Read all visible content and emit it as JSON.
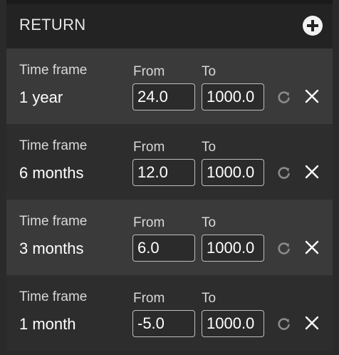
{
  "header": {
    "title": "RETURN",
    "add_icon": "plus-circle-icon"
  },
  "column_labels": {
    "time_frame": "Time frame",
    "from": "From",
    "to": "To"
  },
  "rows": [
    {
      "time_frame": "1 year",
      "from": "24.0",
      "to": "1000.0"
    },
    {
      "time_frame": "6 months",
      "from": "12.0",
      "to": "1000.0"
    },
    {
      "time_frame": "3 months",
      "from": "6.0",
      "to": "1000.0"
    },
    {
      "time_frame": "1 month",
      "from": "-5.0",
      "to": "1000.0"
    }
  ],
  "icons": {
    "reset": "refresh-icon",
    "remove": "close-icon"
  },
  "colors": {
    "background": "#2a2a2a",
    "header": "#232323",
    "row_light": "#3a3a3a",
    "row_dark": "#2d2d2d",
    "text": "#ffffff",
    "muted_icon": "#8a8a8a"
  }
}
